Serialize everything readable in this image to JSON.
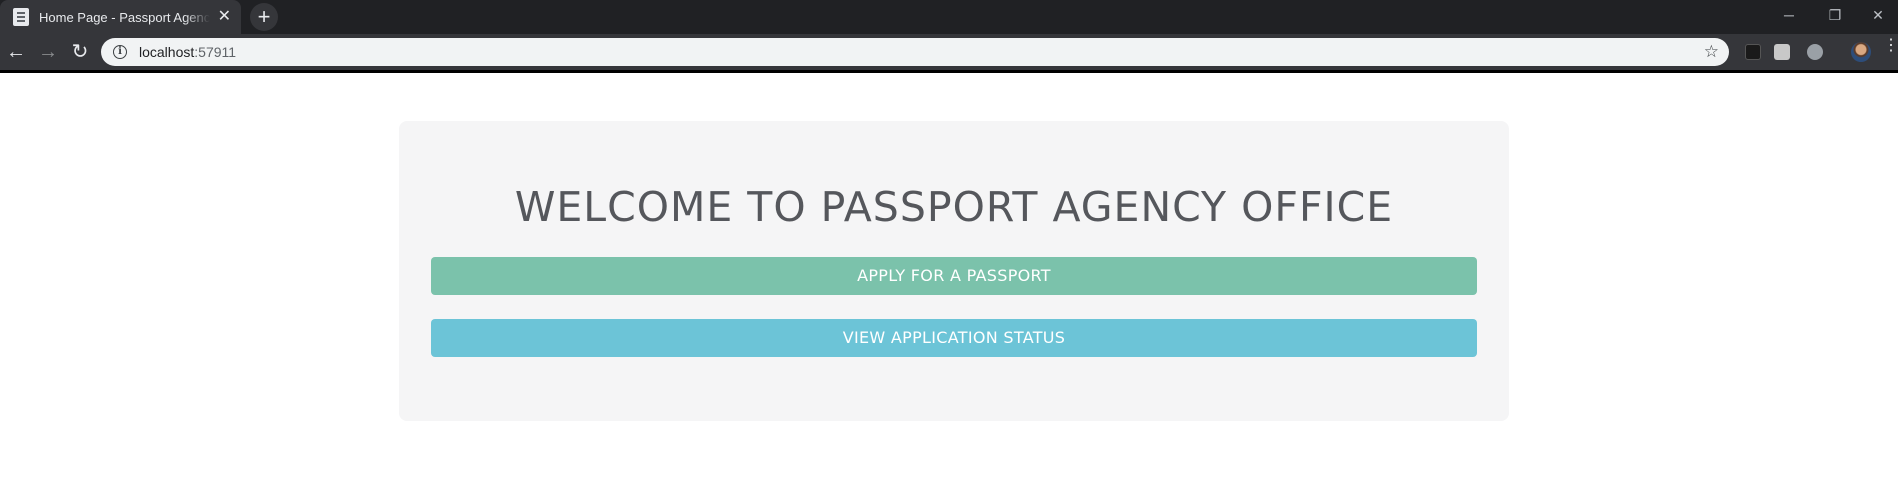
{
  "browser": {
    "tab": {
      "title": "Home Page - Passport Agency Office"
    },
    "new_tab_glyph": "+",
    "tab_close_glyph": "✕",
    "window_controls": {
      "minimize": "─",
      "restore": "❐",
      "close": "✕"
    },
    "nav": {
      "back": "←",
      "forward": "→",
      "reload": "↻"
    },
    "address": {
      "host": "localhost",
      "port": ":57911"
    },
    "bookmark_glyph": "☆",
    "menu_glyph": "⋮",
    "extensions": [
      {
        "name": "cube-extension-icon",
        "color": "#1a1a1a"
      },
      {
        "name": "media-extension-icon",
        "color": "#c8c8c8"
      },
      {
        "name": "spiral-extension-icon",
        "color": "#9aa0a6"
      }
    ]
  },
  "page": {
    "heading": "WELCOME TO PASSPORT AGENCY OFFICE",
    "buttons": {
      "apply": "APPLY FOR A PASSPORT",
      "status": "VIEW APPLICATION STATUS"
    },
    "colors": {
      "apply_button": "#7bc2ab",
      "status_button": "#6cc4d7",
      "card_background": "#f5f5f6",
      "heading_text": "#55575c"
    }
  }
}
